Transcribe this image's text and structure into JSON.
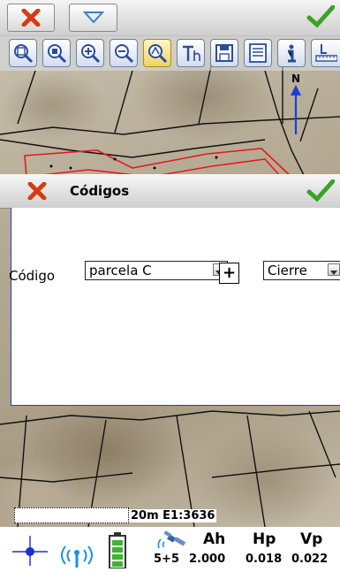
{
  "app": {
    "accent_color": "#2a39c4",
    "close_color": "#d83a12",
    "ok_color": "#3aa227"
  },
  "toolbar": {
    "tools": [
      {
        "icon": "zoom-extents-icon"
      },
      {
        "icon": "zoom-window-icon"
      },
      {
        "icon": "zoom-in-icon"
      },
      {
        "icon": "zoom-out-icon"
      },
      {
        "icon": "pan-zoom-icon",
        "active": true
      },
      {
        "icon": "text-height-icon"
      },
      {
        "icon": "save-icon"
      },
      {
        "icon": "layers-list-icon"
      },
      {
        "icon": "info-icon"
      },
      {
        "icon": "measure-icon"
      }
    ]
  },
  "map": {
    "north_label": "N"
  },
  "dialog": {
    "title": "Códigos",
    "codigo_label": "Código",
    "code_value": "parcela C",
    "plus_label": "+",
    "action_value": "Cierre"
  },
  "status": {
    "scale_text": "20m E1:3636",
    "satellites": "5+5",
    "ah_label": "Ah",
    "ah_value": "2.000",
    "hp_label": "Hp",
    "hp_value": "0.018",
    "vp_label": "Vp",
    "vp_value": "0.022"
  }
}
